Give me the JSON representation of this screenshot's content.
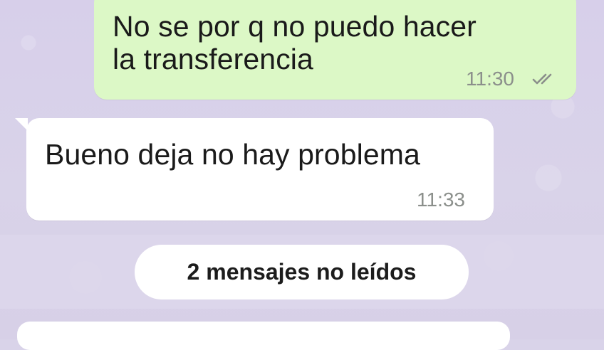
{
  "chat": {
    "messages": [
      {
        "direction": "outgoing",
        "text": "No se por q no puedo hacer\nla transferencia",
        "time": "11:30",
        "status_icon": "double-check-icon"
      },
      {
        "direction": "incoming",
        "text": "Bueno deja no hay problema",
        "time": "11:33"
      }
    ],
    "unread_notice": "2 mensajes no leídos",
    "colors": {
      "background": "#d9d3e9",
      "outgoing_bubble": "#dcf8c6",
      "incoming_bubble": "#ffffff",
      "timestamp": "#8b8f8b"
    }
  }
}
